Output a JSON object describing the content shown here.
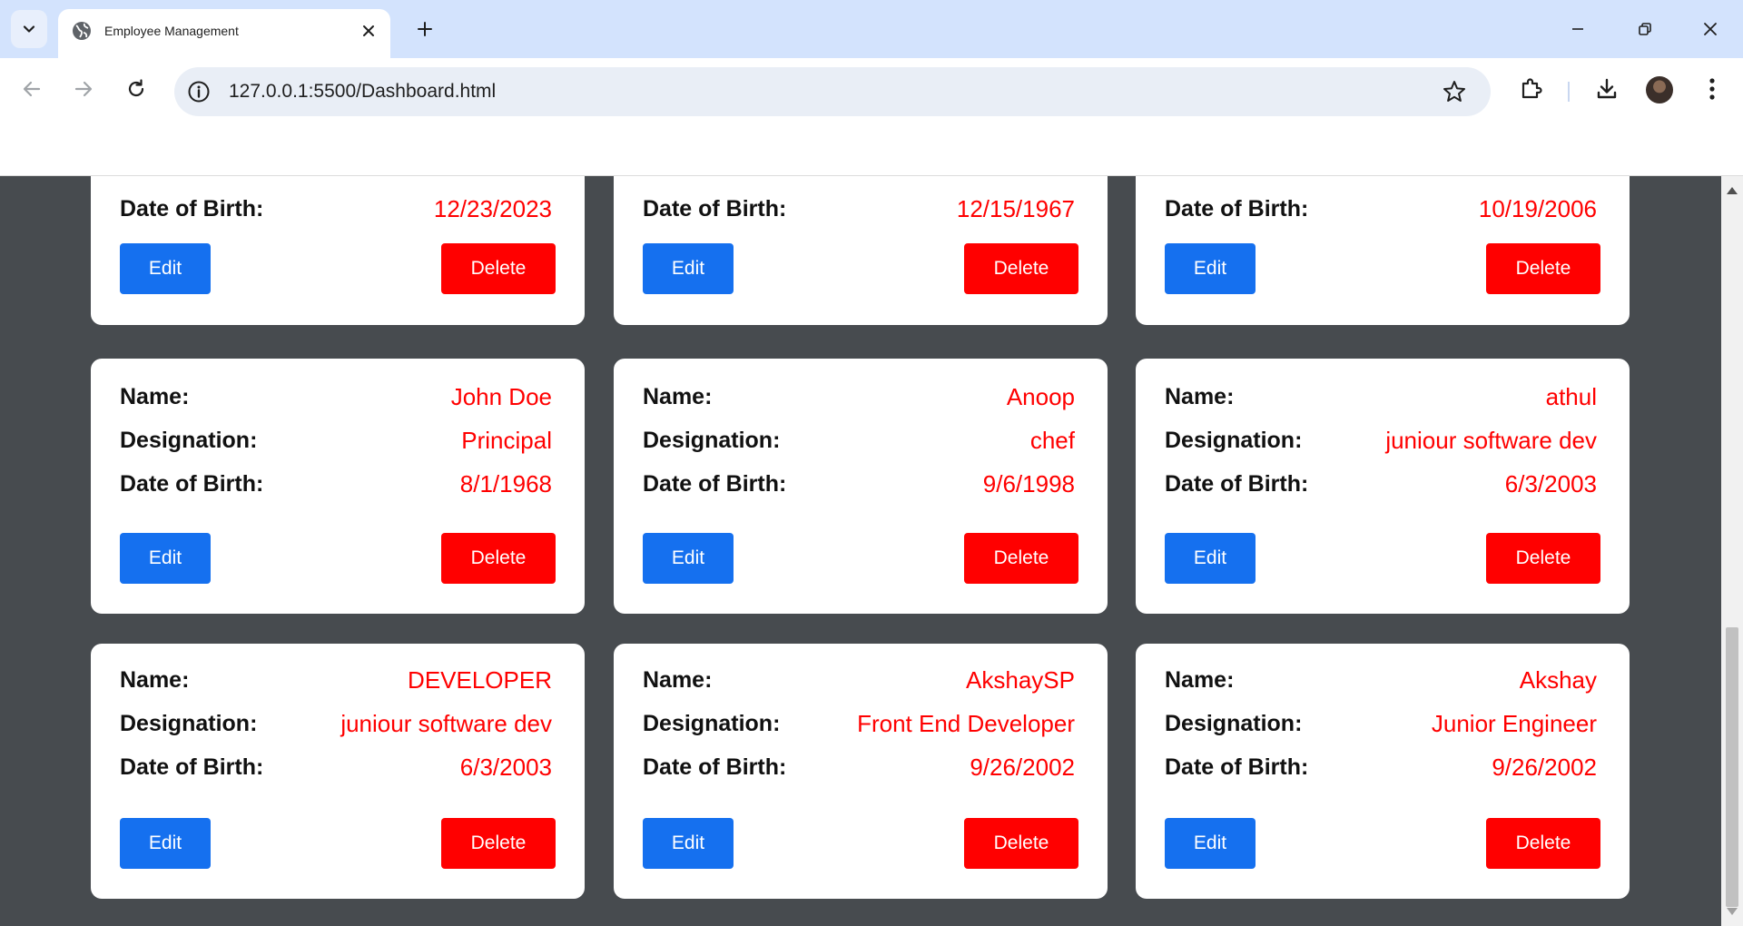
{
  "browser": {
    "tab_title": "Employee Management",
    "url": "127.0.0.1:5500/Dashboard.html"
  },
  "labels": {
    "name": "Name:",
    "designation": "Designation:",
    "dob": "Date of Birth:",
    "edit": "Edit",
    "delete": "Delete"
  },
  "top_row": [
    {
      "dob": "12/23/2023"
    },
    {
      "dob": "12/15/1967"
    },
    {
      "dob": "10/19/2006"
    }
  ],
  "employees": [
    {
      "name": "John Doe",
      "designation": "Principal",
      "dob": "8/1/1968"
    },
    {
      "name": "Anoop",
      "designation": "chef",
      "dob": "9/6/1998"
    },
    {
      "name": "athul",
      "designation": "juniour software dev",
      "dob": "6/3/2003"
    },
    {
      "name": "DEVELOPER",
      "designation": "juniour software dev",
      "dob": "6/3/2003"
    },
    {
      "name": "AkshaySP",
      "designation": "Front End Developer",
      "dob": "9/26/2002"
    },
    {
      "name": "Akshay",
      "designation": "Junior Engineer",
      "dob": "9/26/2002"
    }
  ],
  "colors": {
    "page_background": "#474b4f",
    "value_text": "#ff0000",
    "edit_button": "#1570ef",
    "delete_button": "#ff0000"
  }
}
